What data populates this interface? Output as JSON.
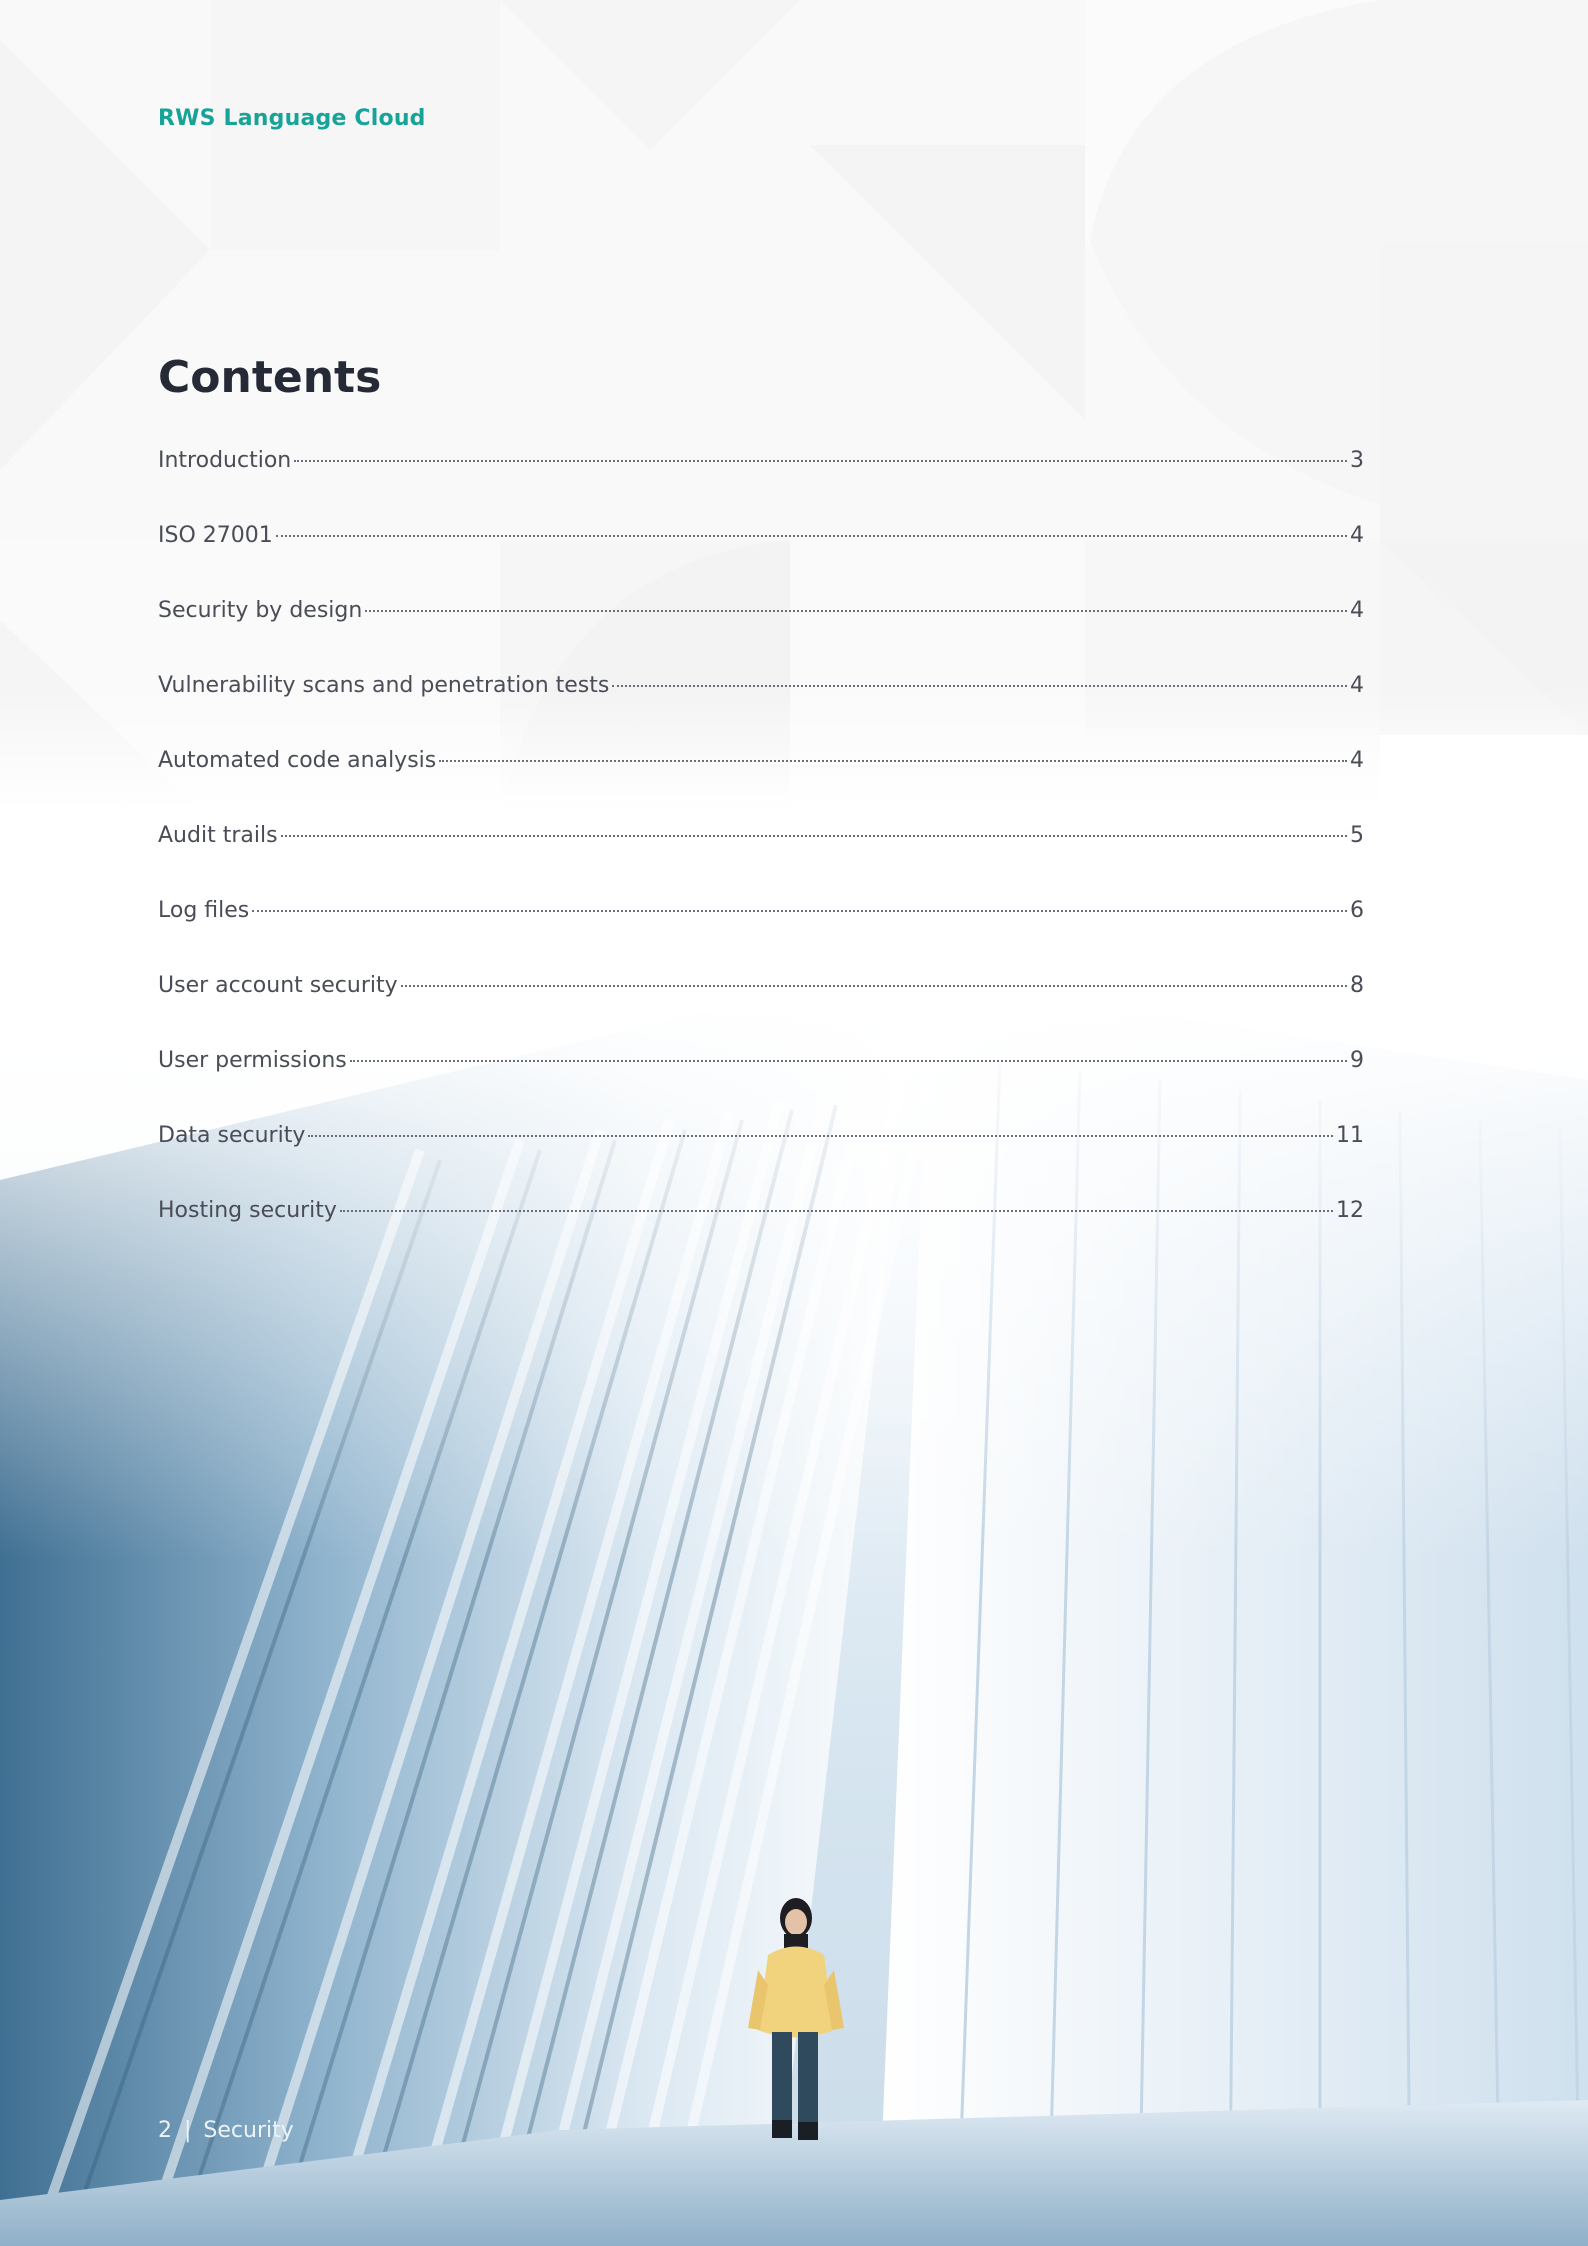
{
  "header": {
    "brand": "RWS Language Cloud"
  },
  "toc": {
    "title": "Contents",
    "entries": [
      {
        "label": "Introduction",
        "page": "3"
      },
      {
        "label": "ISO 27001",
        "page": "4"
      },
      {
        "label": "Security by design",
        "page": "4"
      },
      {
        "label": "Vulnerability scans and penetration tests",
        "page": "4"
      },
      {
        "label": "Automated code analysis",
        "page": "4"
      },
      {
        "label": "Audit trails",
        "page": "5"
      },
      {
        "label": "Log files",
        "page": "6"
      },
      {
        "label": "User account security",
        "page": "8"
      },
      {
        "label": "User permissions",
        "page": "9"
      },
      {
        "label": "Data security",
        "page": "11"
      },
      {
        "label": "Hosting security",
        "page": "12"
      }
    ]
  },
  "footer": {
    "page_number": "2",
    "separator": "|",
    "section": "Security"
  },
  "colors": {
    "brand_teal": "#17a398",
    "heading": "#262a36",
    "body_text": "#4a4d57"
  }
}
